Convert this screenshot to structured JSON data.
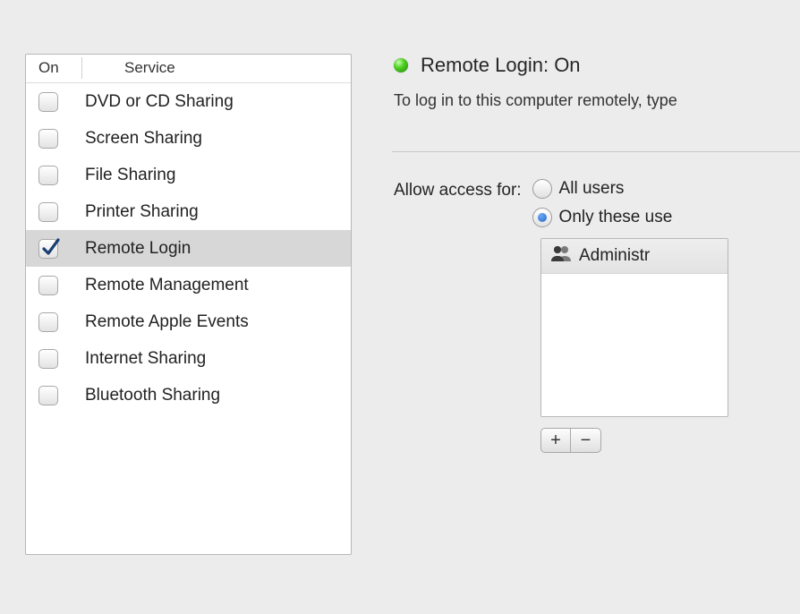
{
  "services_header": {
    "on": "On",
    "service": "Service"
  },
  "services": [
    {
      "label": "DVD or CD Sharing",
      "checked": false,
      "selected": false
    },
    {
      "label": "Screen Sharing",
      "checked": false,
      "selected": false
    },
    {
      "label": "File Sharing",
      "checked": false,
      "selected": false
    },
    {
      "label": "Printer Sharing",
      "checked": false,
      "selected": false
    },
    {
      "label": "Remote Login",
      "checked": true,
      "selected": true
    },
    {
      "label": "Remote Management",
      "checked": false,
      "selected": false
    },
    {
      "label": "Remote Apple Events",
      "checked": false,
      "selected": false
    },
    {
      "label": "Internet Sharing",
      "checked": false,
      "selected": false
    },
    {
      "label": "Bluetooth Sharing",
      "checked": false,
      "selected": false
    }
  ],
  "status": {
    "title": "Remote Login: On",
    "description": "To log in to this computer remotely, type"
  },
  "access": {
    "label": "Allow access for:",
    "all_users": "All users",
    "only_these": "Only these use",
    "selected": "only_these"
  },
  "users": [
    {
      "label": "Administr"
    }
  ],
  "buttons": {
    "add": "+",
    "remove": "−"
  },
  "colors": {
    "led_green": "#4ecf1f",
    "selection_gray": "#d7d7d7"
  }
}
